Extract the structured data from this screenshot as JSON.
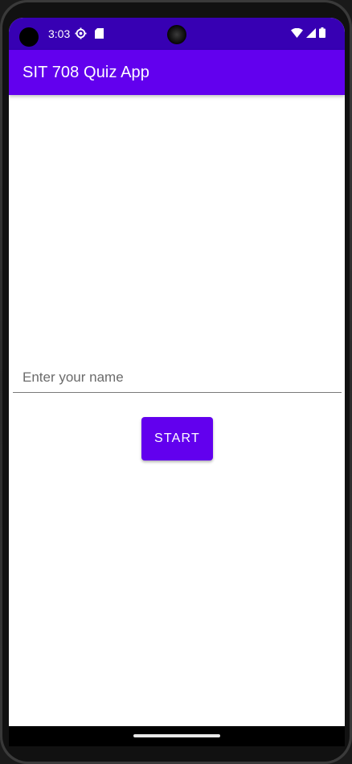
{
  "status_bar": {
    "time": "3:03",
    "icons": [
      "settings-gear-icon",
      "sd-card-icon",
      "wifi-icon",
      "cell-signal-icon",
      "battery-icon"
    ]
  },
  "app_bar": {
    "title": "SIT 708 Quiz App",
    "color": "#6200ee"
  },
  "name_field": {
    "placeholder": "Enter your name",
    "value": ""
  },
  "start_button": {
    "label": "START",
    "color": "#6200ee"
  },
  "colors": {
    "status_bar": "#3700b3",
    "primary": "#6200ee",
    "background": "#ffffff"
  }
}
